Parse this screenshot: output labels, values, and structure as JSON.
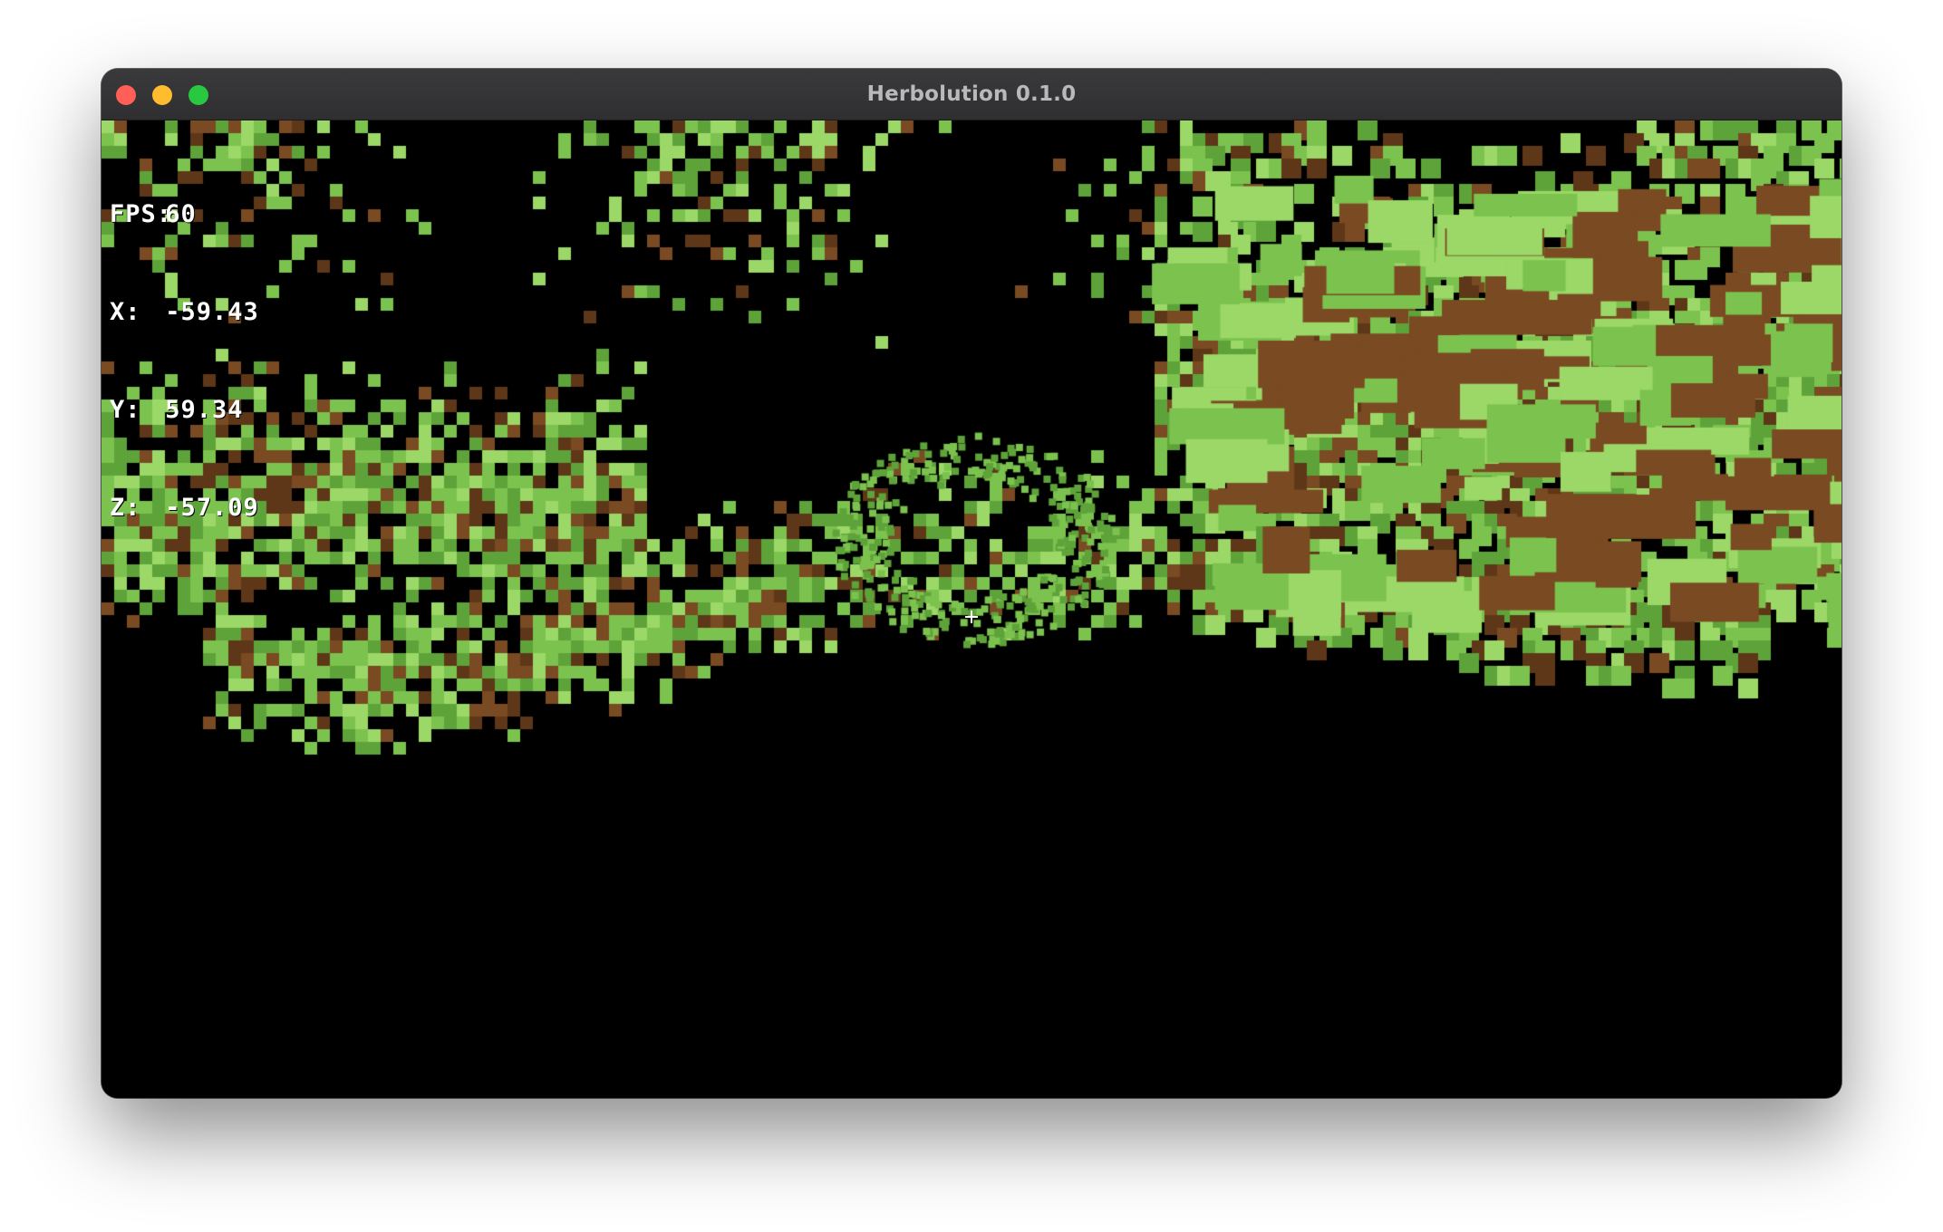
{
  "window": {
    "title": "Herbolution 0.1.0",
    "controls": {
      "close_color": "#ff5f57",
      "minimize_color": "#febc2e",
      "zoom_color": "#28c840"
    }
  },
  "hud": {
    "fps_label": "FPS:",
    "fps_value": "60",
    "x_label": "X:",
    "x_value": "-59.43",
    "y_label": "Y:",
    "y_value": "59.34",
    "z_label": "Z:",
    "z_value": "-57.09"
  },
  "scene": {
    "description_colors": {
      "grass": "#7cc24e",
      "grass_dark": "#5ea33a",
      "grass_light": "#9bd867",
      "dirt": "#7a4a22",
      "dirt_dark": "#5e3718",
      "sky": "#000000"
    }
  }
}
